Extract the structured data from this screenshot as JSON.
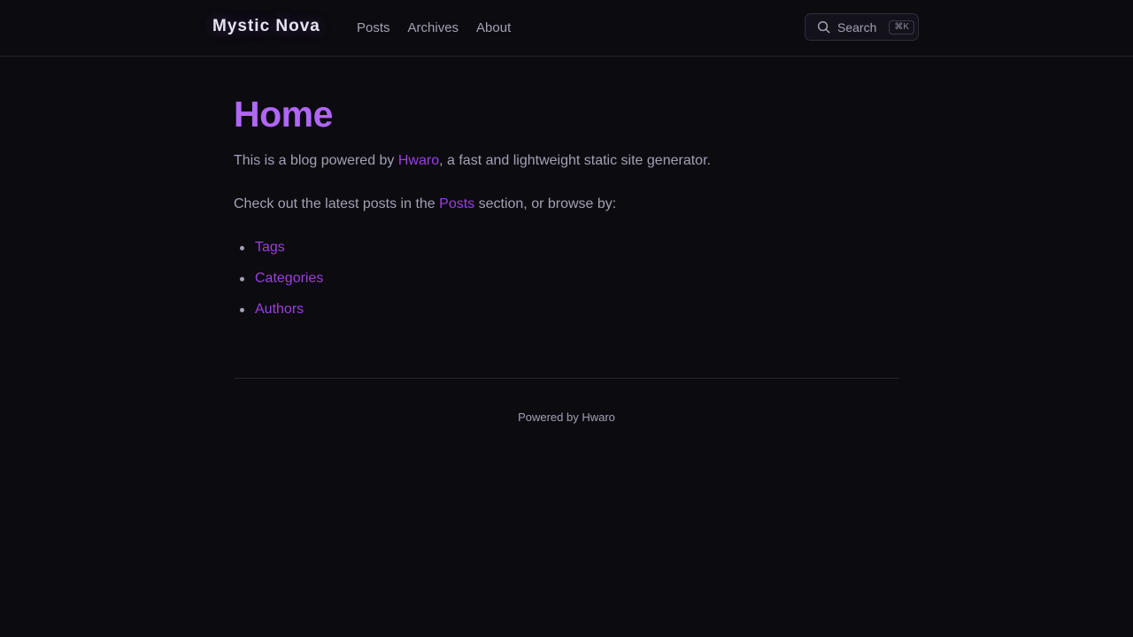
{
  "header": {
    "site_title": "Mystic Nova",
    "nav": [
      {
        "label": "Posts"
      },
      {
        "label": "Archives"
      },
      {
        "label": "About"
      }
    ],
    "search": {
      "label": "Search",
      "shortcut": "⌘K",
      "icon": "search-icon"
    }
  },
  "main": {
    "title": "Home",
    "intro": {
      "before": "This is a blog powered by ",
      "link": "Hwaro",
      "after": ", a fast and lightweight static site generator."
    },
    "browse": {
      "before": "Check out the latest posts in the ",
      "link": "Posts",
      "after": " section, or browse by:"
    },
    "links": [
      {
        "label": "Tags"
      },
      {
        "label": "Categories"
      },
      {
        "label": "Authors"
      }
    ]
  },
  "footer": {
    "text": "Powered by Hwaro"
  },
  "colors": {
    "background": "#0c0b10",
    "accent": "#b066f7",
    "link": "#9b3fe0",
    "text": "#a3a1b2",
    "brand_text": "#e6e4ee"
  }
}
